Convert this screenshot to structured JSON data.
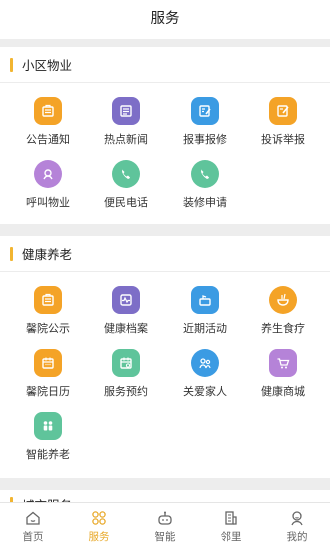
{
  "header": {
    "title": "服务"
  },
  "colors": {
    "accent": "#f2b531",
    "orange": "#f4a327",
    "purple": "#7d6ec7",
    "blue": "#3b9be3",
    "green": "#5fc49b",
    "violet": "#b583d8"
  },
  "sections": [
    {
      "title": "小区物业",
      "items": [
        {
          "label": "公告通知",
          "icon": "notice-icon"
        },
        {
          "label": "热点新闻",
          "icon": "news-icon"
        },
        {
          "label": "报事报修",
          "icon": "repair-icon"
        },
        {
          "label": "投诉举报",
          "icon": "complaint-icon"
        },
        {
          "label": "呼叫物业",
          "icon": "call-property-icon"
        },
        {
          "label": "便民电话",
          "icon": "phone-icon"
        },
        {
          "label": "装修申请",
          "icon": "renovation-icon"
        }
      ]
    },
    {
      "title": "健康养老",
      "items": [
        {
          "label": "馨院公示",
          "icon": "notice-icon"
        },
        {
          "label": "健康档案",
          "icon": "health-record-icon"
        },
        {
          "label": "近期活动",
          "icon": "activity-icon"
        },
        {
          "label": "养生食疗",
          "icon": "food-icon"
        },
        {
          "label": "馨院日历",
          "icon": "calendar-icon"
        },
        {
          "label": "服务预约",
          "icon": "appointment-icon"
        },
        {
          "label": "关爱家人",
          "icon": "family-icon"
        },
        {
          "label": "健康商城",
          "icon": "cart-icon"
        },
        {
          "label": "智能养老",
          "icon": "elderly-icon"
        }
      ]
    },
    {
      "title": "城市服务"
    }
  ],
  "tabbar": [
    {
      "label": "首页",
      "icon": "home-icon"
    },
    {
      "label": "服务",
      "icon": "service-icon",
      "active": true
    },
    {
      "label": "智能",
      "icon": "robot-icon"
    },
    {
      "label": "邻里",
      "icon": "building-icon"
    },
    {
      "label": "我的",
      "icon": "profile-icon"
    }
  ]
}
